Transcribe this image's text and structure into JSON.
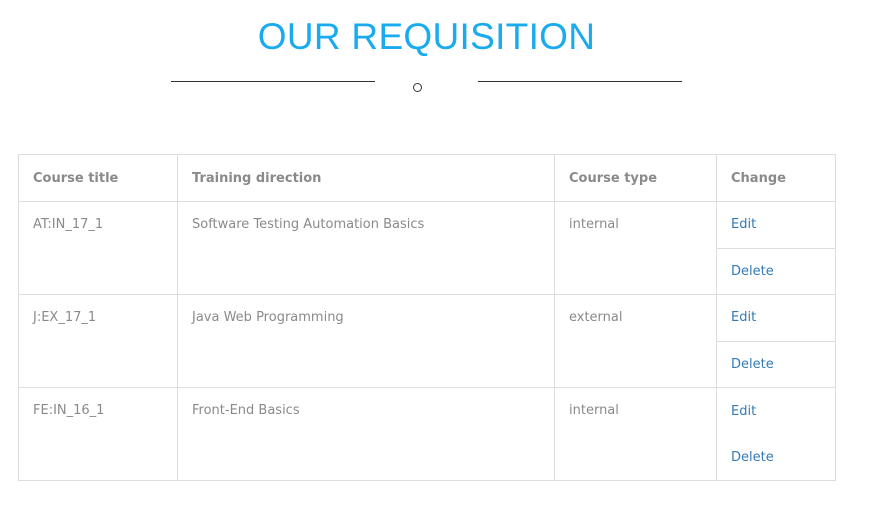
{
  "header": {
    "title": "OUR REQUISITION"
  },
  "table": {
    "columns": [
      "Course title",
      "Training direction",
      "Course type",
      "Change"
    ],
    "rows": [
      {
        "course_title": "AT:IN_17_1",
        "training_direction": "Software Testing Automation Basics",
        "course_type": "internal",
        "edit_label": "Edit",
        "delete_label": "Delete"
      },
      {
        "course_title": "J:EX_17_1",
        "training_direction": "Java Web Programming",
        "course_type": "external",
        "edit_label": "Edit",
        "delete_label": "Delete"
      },
      {
        "course_title": "FE:IN_16_1",
        "training_direction": "Front-End Basics",
        "course_type": "internal",
        "edit_label": "Edit",
        "delete_label": "Delete"
      }
    ]
  },
  "colors": {
    "title": "#1aabef",
    "link": "#337ab7",
    "text": "#8a8a8a",
    "border": "#dddddd"
  }
}
